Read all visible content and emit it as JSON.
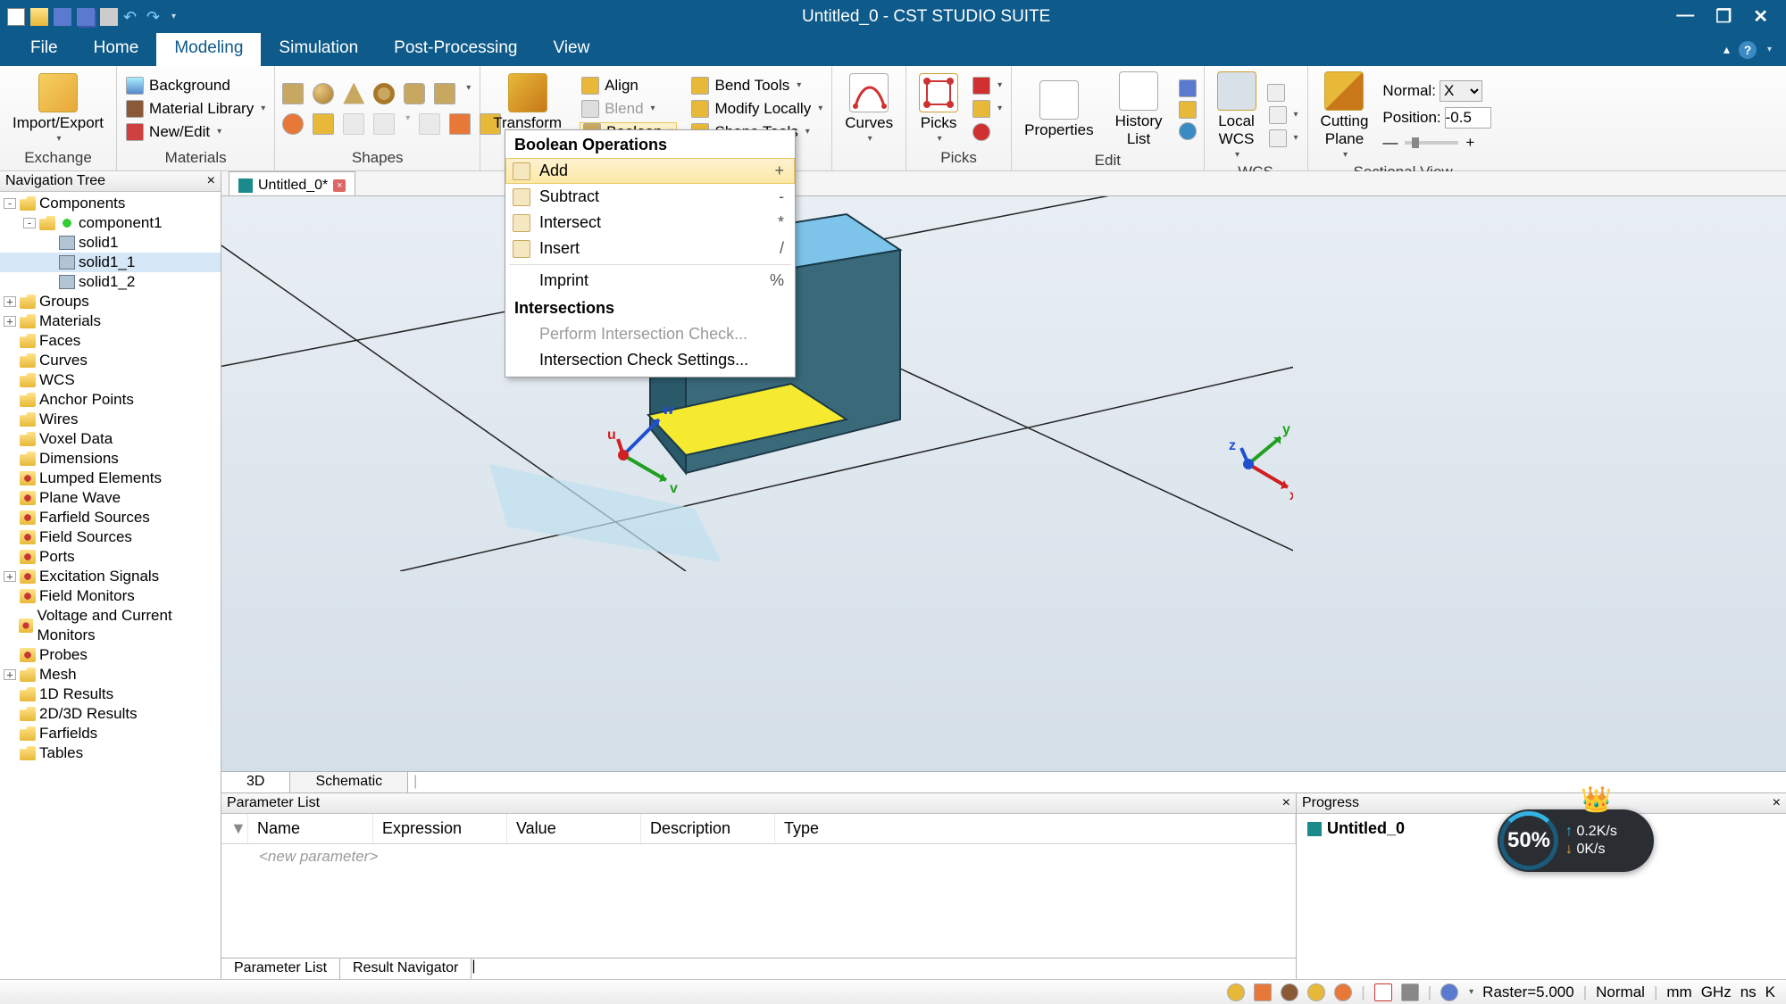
{
  "titlebar": {
    "title": "Untitled_0 - CST STUDIO SUITE"
  },
  "menutabs": [
    "File",
    "Home",
    "Modeling",
    "Simulation",
    "Post-Processing",
    "View"
  ],
  "active_tab": "Modeling",
  "ribbon": {
    "exchange": {
      "label": "Exchange",
      "import_export": "Import/Export"
    },
    "materials": {
      "label": "Materials",
      "background": "Background",
      "material_library": "Material Library",
      "new_edit": "New/Edit"
    },
    "shapes": {
      "label": "Shapes"
    },
    "transform_group": {
      "transform": "Transform",
      "align": "Align",
      "blend": "Blend",
      "boolean": "Boolean",
      "bend_tools": "Bend Tools",
      "modify_locally": "Modify Locally",
      "shape_tools": "Shape Tools"
    },
    "curves": {
      "label": "Curves"
    },
    "picks": {
      "p1": "Picks",
      "label": "Picks"
    },
    "edit": {
      "properties": "Properties",
      "history_list": "History\nList",
      "label": "Edit"
    },
    "wcs": {
      "local_wcs": "Local\nWCS",
      "label": "WCS"
    },
    "sectional": {
      "cutting_plane": "Cutting\nPlane",
      "normal_label": "Normal:",
      "normal_value": "X",
      "position_label": "Position:",
      "position_value": "-0.5",
      "label": "Sectional View"
    }
  },
  "boolean_menu": {
    "header1": "Boolean Operations",
    "items": [
      {
        "label": "Add",
        "short": "+",
        "hover": true
      },
      {
        "label": "Subtract",
        "short": "-"
      },
      {
        "label": "Intersect",
        "short": "*"
      },
      {
        "label": "Insert",
        "short": "/"
      },
      {
        "label": "Imprint",
        "short": "%",
        "noicon": true
      }
    ],
    "header2": "Intersections",
    "items2": [
      {
        "label": "Perform Intersection Check...",
        "disabled": true
      },
      {
        "label": "Intersection Check Settings..."
      }
    ]
  },
  "navtree": {
    "title": "Navigation Tree",
    "nodes": [
      {
        "d": 0,
        "exp": "-",
        "icon": "folder",
        "label": "Components"
      },
      {
        "d": 1,
        "exp": "-",
        "icon": "folder",
        "label": "component1",
        "extra_icon": true
      },
      {
        "d": 2,
        "exp": " ",
        "icon": "box3d",
        "label": "solid1"
      },
      {
        "d": 2,
        "exp": " ",
        "icon": "box3d",
        "label": "solid1_1",
        "sel": true
      },
      {
        "d": 2,
        "exp": " ",
        "icon": "box3d",
        "label": "solid1_2"
      },
      {
        "d": 0,
        "exp": "+",
        "icon": "folder",
        "label": "Groups"
      },
      {
        "d": 0,
        "exp": "+",
        "icon": "folder",
        "label": "Materials"
      },
      {
        "d": 0,
        "exp": " ",
        "icon": "folder",
        "label": "Faces"
      },
      {
        "d": 0,
        "exp": " ",
        "icon": "folder",
        "label": "Curves"
      },
      {
        "d": 0,
        "exp": " ",
        "icon": "folder",
        "label": "WCS"
      },
      {
        "d": 0,
        "exp": " ",
        "icon": "folder",
        "label": "Anchor Points"
      },
      {
        "d": 0,
        "exp": " ",
        "icon": "folder",
        "label": "Wires"
      },
      {
        "d": 0,
        "exp": " ",
        "icon": "folder",
        "label": "Voxel Data"
      },
      {
        "d": 0,
        "exp": " ",
        "icon": "folder",
        "label": "Dimensions"
      },
      {
        "d": 0,
        "exp": " ",
        "icon": "gear",
        "label": "Lumped Elements"
      },
      {
        "d": 0,
        "exp": " ",
        "icon": "gear",
        "label": "Plane Wave"
      },
      {
        "d": 0,
        "exp": " ",
        "icon": "gear",
        "label": "Farfield Sources"
      },
      {
        "d": 0,
        "exp": " ",
        "icon": "gear",
        "label": "Field Sources"
      },
      {
        "d": 0,
        "exp": " ",
        "icon": "gear",
        "label": "Ports"
      },
      {
        "d": 0,
        "exp": "+",
        "icon": "gear",
        "label": "Excitation Signals"
      },
      {
        "d": 0,
        "exp": " ",
        "icon": "gear",
        "label": "Field Monitors"
      },
      {
        "d": 0,
        "exp": " ",
        "icon": "gear",
        "label": "Voltage and Current Monitors"
      },
      {
        "d": 0,
        "exp": " ",
        "icon": "gear",
        "label": "Probes"
      },
      {
        "d": 0,
        "exp": "+",
        "icon": "folder",
        "label": "Mesh"
      },
      {
        "d": 0,
        "exp": " ",
        "icon": "folder",
        "label": "1D Results"
      },
      {
        "d": 0,
        "exp": " ",
        "icon": "folder",
        "label": "2D/3D Results"
      },
      {
        "d": 0,
        "exp": " ",
        "icon": "folder",
        "label": "Farfields"
      },
      {
        "d": 0,
        "exp": " ",
        "icon": "folder",
        "label": "Tables"
      }
    ]
  },
  "doc_tab": {
    "label": "Untitled_0*"
  },
  "view_tabs": {
    "t1": "3D",
    "t2": "Schematic"
  },
  "param_panel": {
    "title": "Parameter List",
    "cols": [
      "Name",
      "Expression",
      "Value",
      "Description",
      "Type"
    ],
    "placeholder": "<new parameter>",
    "tabs": [
      "Parameter List",
      "Result Navigator"
    ]
  },
  "progress_panel": {
    "title": "Progress",
    "item": "Untitled_0"
  },
  "speed_widget": {
    "pct": "50%",
    "up": "0.2K/s",
    "down": "0K/s"
  },
  "statusbar": {
    "raster": "Raster=5.000",
    "normal": "Normal",
    "units": [
      "mm",
      "GHz",
      "ns",
      "K"
    ]
  },
  "axes": {
    "u": "u",
    "v": "v",
    "w": "w",
    "x": "x",
    "y": "y",
    "z": "z"
  }
}
